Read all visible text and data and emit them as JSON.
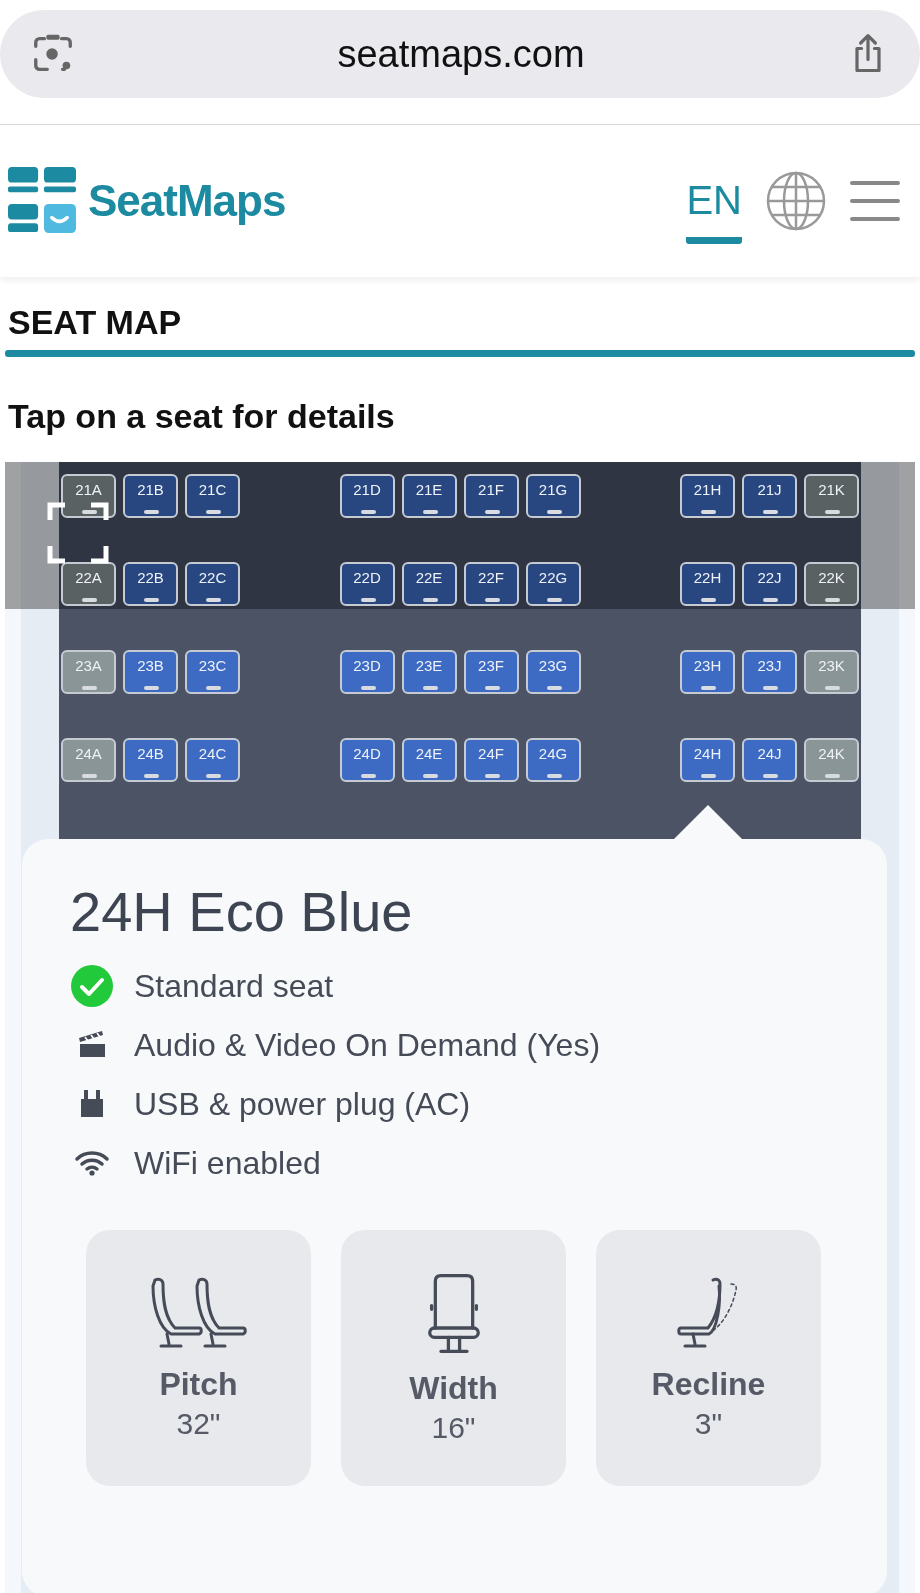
{
  "browser": {
    "url": "seatmaps.com"
  },
  "header": {
    "brand": "SeatMaps",
    "language": {
      "label": "EN",
      "selected": true
    }
  },
  "section_title": "SEAT MAP",
  "instruction": "Tap on a seat for details",
  "seat_rows": [
    {
      "blocks": [
        [
          {
            "label": "21A",
            "color": "#5a6163"
          },
          {
            "label": "21B",
            "color": "#284680"
          },
          {
            "label": "21C",
            "color": "#284680"
          }
        ],
        [
          {
            "label": "21D",
            "color": "#284680"
          },
          {
            "label": "21E",
            "color": "#284680"
          },
          {
            "label": "21F",
            "color": "#284680"
          },
          {
            "label": "21G",
            "color": "#284680"
          }
        ],
        [
          {
            "label": "21H",
            "color": "#284680"
          },
          {
            "label": "21J",
            "color": "#284680"
          },
          {
            "label": "21K",
            "color": "#5a6163"
          }
        ]
      ]
    },
    {
      "blocks": [
        [
          {
            "label": "22A",
            "color": "#5a6163"
          },
          {
            "label": "22B",
            "color": "#284680"
          },
          {
            "label": "22C",
            "color": "#284680"
          }
        ],
        [
          {
            "label": "22D",
            "color": "#284680"
          },
          {
            "label": "22E",
            "color": "#284680"
          },
          {
            "label": "22F",
            "color": "#284680"
          },
          {
            "label": "22G",
            "color": "#284680"
          }
        ],
        [
          {
            "label": "22H",
            "color": "#284680"
          },
          {
            "label": "22J",
            "color": "#284680"
          },
          {
            "label": "22K",
            "color": "#5a6163"
          }
        ]
      ]
    },
    {
      "blocks": [
        [
          {
            "label": "23A",
            "color": "#8a9598"
          },
          {
            "label": "23B",
            "color": "#3d6bc4"
          },
          {
            "label": "23C",
            "color": "#3d6bc4"
          }
        ],
        [
          {
            "label": "23D",
            "color": "#3d6bc4"
          },
          {
            "label": "23E",
            "color": "#3d6bc4"
          },
          {
            "label": "23F",
            "color": "#3d6bc4"
          },
          {
            "label": "23G",
            "color": "#3d6bc4"
          }
        ],
        [
          {
            "label": "23H",
            "color": "#3d6bc4"
          },
          {
            "label": "23J",
            "color": "#3d6bc4"
          },
          {
            "label": "23K",
            "color": "#8a9598"
          }
        ]
      ]
    },
    {
      "blocks": [
        [
          {
            "label": "24A",
            "color": "#8a9598"
          },
          {
            "label": "24B",
            "color": "#3d6bc4"
          },
          {
            "label": "24C",
            "color": "#3d6bc4"
          }
        ],
        [
          {
            "label": "24D",
            "color": "#3d6bc4"
          },
          {
            "label": "24E",
            "color": "#3d6bc4"
          },
          {
            "label": "24F",
            "color": "#3d6bc4"
          },
          {
            "label": "24G",
            "color": "#3d6bc4"
          }
        ],
        [
          {
            "label": "24H",
            "color": "#3d6bc4"
          },
          {
            "label": "24J",
            "color": "#3d6bc4"
          },
          {
            "label": "24K",
            "color": "#8a9598"
          }
        ]
      ]
    }
  ],
  "seat_popup": {
    "title": "24H Eco Blue",
    "features": [
      {
        "kind": "check",
        "text": "Standard seat"
      },
      {
        "kind": "media",
        "text": "Audio & Video On Demand (Yes)"
      },
      {
        "kind": "power",
        "text": "USB & power plug (AC)"
      },
      {
        "kind": "wifi",
        "text": "WiFi enabled"
      }
    ],
    "specs": [
      {
        "kind": "pitch",
        "label": "Pitch",
        "value": "32\""
      },
      {
        "kind": "width",
        "label": "Width",
        "value": "16\""
      },
      {
        "kind": "recline",
        "label": "Recline",
        "value": "3\""
      }
    ]
  }
}
